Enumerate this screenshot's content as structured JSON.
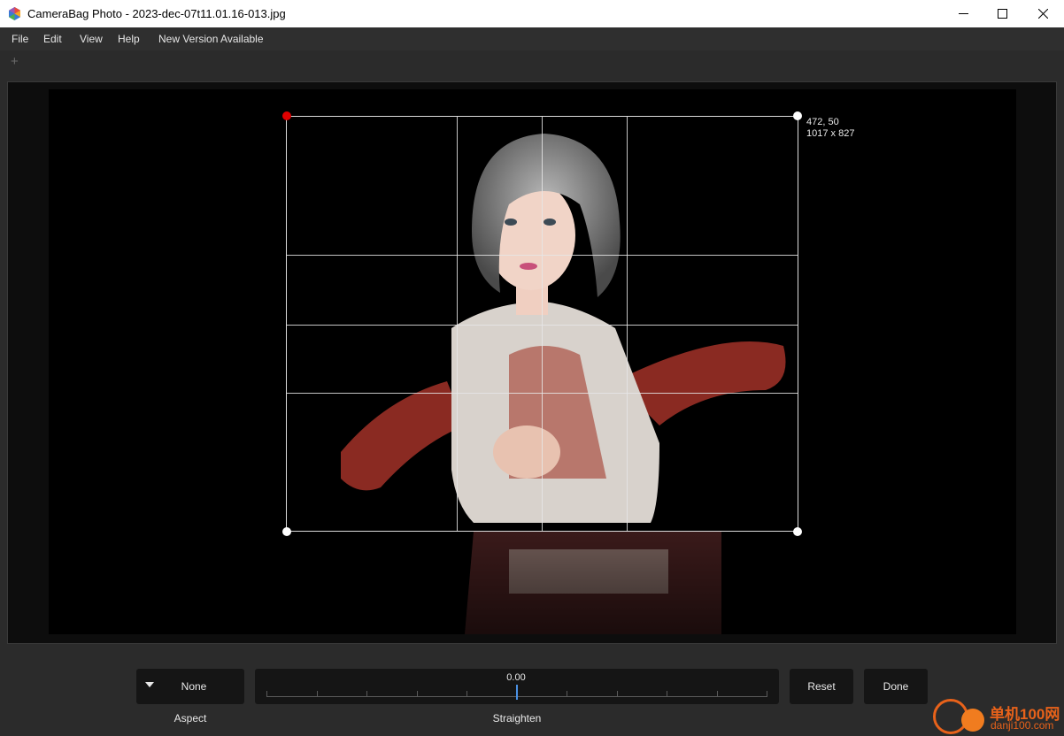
{
  "window": {
    "title": "CameraBag Photo - 2023-dec-07t11.01.16-013.jpg",
    "app_icon": "camerabag-logo-icon",
    "controls": [
      "minimize-icon",
      "maximize-icon",
      "close-icon"
    ]
  },
  "menu": {
    "items": [
      {
        "label": "File"
      },
      {
        "label": "Edit"
      },
      {
        "label": "View"
      },
      {
        "label": "Help"
      },
      {
        "label": "New Version Available"
      }
    ]
  },
  "toolbar": {
    "add_tab": "+"
  },
  "crop": {
    "position": "472, 50",
    "size": "1017 x 827",
    "active_handle_color": "#e00000"
  },
  "controls": {
    "aspect": {
      "value": "None",
      "label": "Aspect"
    },
    "straighten": {
      "value": "0.00",
      "label": "Straighten",
      "accent": "#4a90e2"
    },
    "reset_label": "Reset",
    "done_label": "Done"
  },
  "watermark": {
    "text_cn": "单机100网",
    "text_url": "danji100.com",
    "color": "#e8621a"
  }
}
